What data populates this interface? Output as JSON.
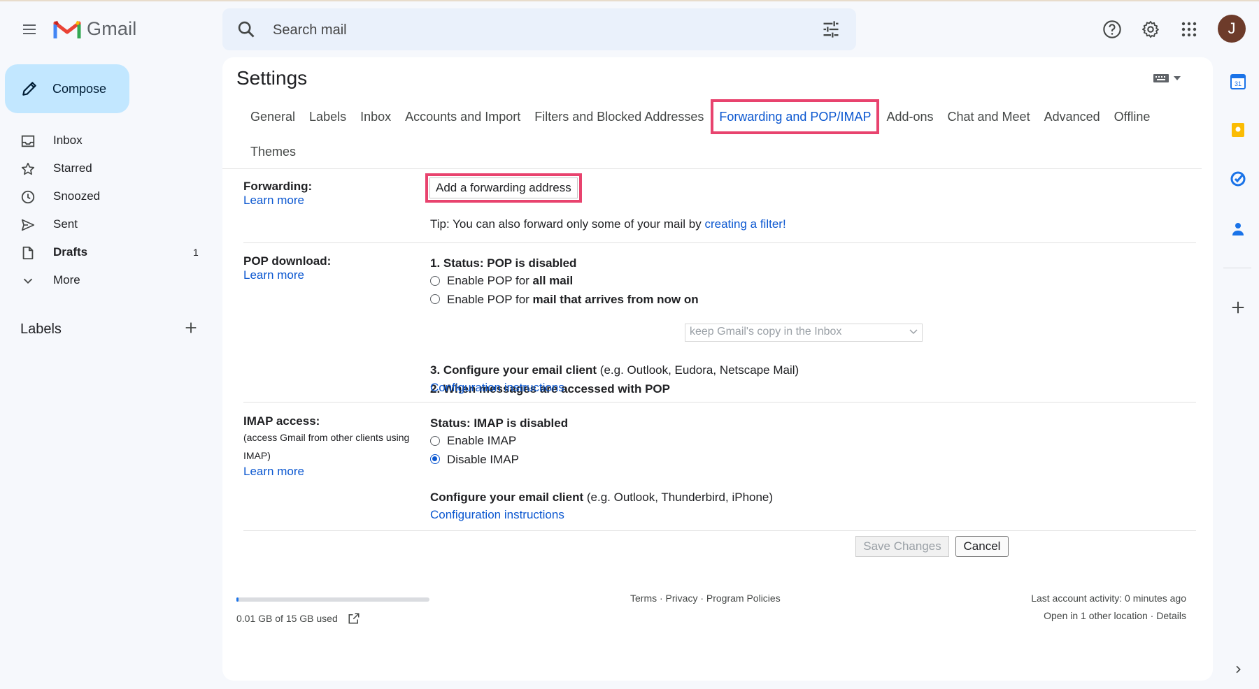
{
  "header": {
    "app_name": "Gmail",
    "search_placeholder": "Search mail",
    "avatar_letter": "J"
  },
  "nav": {
    "compose_label": "Compose",
    "items": [
      {
        "label": "Inbox",
        "icon": "inbox-icon",
        "count": ""
      },
      {
        "label": "Starred",
        "icon": "star-icon",
        "count": ""
      },
      {
        "label": "Snoozed",
        "icon": "clock-icon",
        "count": ""
      },
      {
        "label": "Sent",
        "icon": "send-icon",
        "count": ""
      },
      {
        "label": "Drafts",
        "icon": "draft-icon",
        "count": "1"
      },
      {
        "label": "More",
        "icon": "chevron-down-icon",
        "count": ""
      }
    ],
    "labels_heading": "Labels"
  },
  "settings": {
    "title": "Settings",
    "tabs": [
      "General",
      "Labels",
      "Inbox",
      "Accounts and Import",
      "Filters and Blocked Addresses",
      "Forwarding and POP/IMAP",
      "Add-ons",
      "Chat and Meet",
      "Advanced",
      "Offline",
      "Themes"
    ],
    "active_tab": "Forwarding and POP/IMAP",
    "forwarding": {
      "label": "Forwarding:",
      "learn_more": "Learn more",
      "add_button": "Add a forwarding address",
      "tip_prefix": "Tip: You can also forward only some of your mail by ",
      "tip_link": "creating a filter!"
    },
    "pop": {
      "label": "POP download:",
      "learn_more": "Learn more",
      "status": "1. Status: POP is disabled",
      "opt1_prefix": "Enable POP for ",
      "opt1_bold": "all mail",
      "opt2_prefix": "Enable POP for ",
      "opt2_bold": "mail that arrives from now on",
      "step2": "2. When messages are accessed with POP",
      "select_value": "keep Gmail's copy in the Inbox",
      "step3_bold": "3. Configure your email client",
      "step3_rest": " (e.g. Outlook, Eudora, Netscape Mail)",
      "config_link": "Configuration instructions"
    },
    "imap": {
      "label": "IMAP access:",
      "sub_label": "(access Gmail from other clients using IMAP)",
      "learn_more": "Learn more",
      "status": "Status: IMAP is disabled",
      "enable": "Enable IMAP",
      "disable": "Disable IMAP",
      "selected": "Disable IMAP",
      "config_bold": "Configure your email client",
      "config_rest": " (e.g. Outlook, Thunderbird, iPhone)",
      "config_link": "Configuration instructions"
    },
    "save_label": "Save Changes",
    "cancel_label": "Cancel"
  },
  "footer": {
    "storage_text": "0.01 GB of 15 GB used",
    "storage_used_fraction": 0.0007,
    "links": "Terms · Privacy · Program Policies",
    "activity": "Last account activity: 0 minutes ago",
    "location": "Open in 1 other location · Details"
  },
  "side_panel": {
    "calendar_day": "31"
  },
  "colors": {
    "accent": "#0b57d0",
    "highlight": "#e8436e",
    "compose_bg": "#c2e7ff"
  }
}
